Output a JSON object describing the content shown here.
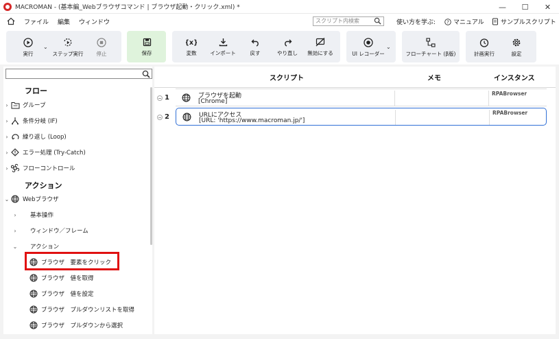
{
  "window": {
    "title": "MACROMAN - (基本編_Webブラウザコマンド | ブラウザ起動・クリック.xml) *",
    "minimize": "—",
    "maximize": "☐",
    "close": "✕"
  },
  "menu": {
    "items": [
      "ファイル",
      "編集",
      "ウィンドウ"
    ],
    "search_placeholder": "スクリプト内検索",
    "learn": "使い方を学ぶ:",
    "manual": "マニュアル",
    "samples": "サンプルスクリプト"
  },
  "toolbar": {
    "run": "実行",
    "step_run": "ステップ実行",
    "stop": "停止",
    "save": "保存",
    "variable": "変数",
    "import": "インポート",
    "undo": "戻す",
    "redo": "やり直し",
    "disable": "無効にする",
    "ui_recorder": "UI レコーダー",
    "flowchart": "フローチャート (β版)",
    "schedule": "計画実行",
    "settings": "設定"
  },
  "tree": {
    "flow_section": "フロー",
    "flow_items": [
      "グループ",
      "条件分岐 (IF)",
      "繰り返し (Loop)",
      "エラー処理 (Try-Catch)",
      "フローコントロール"
    ],
    "action_section": "アクション",
    "web_browser": "Webブラウザ",
    "basic_ops": "基本操作",
    "window_frame": "ウィンドウ／フレーム",
    "actions": "アクション",
    "browser_actions": [
      "ブラウザ　要素をクリック",
      "ブラウザ　値を取得",
      "ブラウザ　値を設定",
      "ブラウザ　プルダウンリストを取得",
      "ブラウザ　プルダウンから選択"
    ]
  },
  "script": {
    "col_script": "スクリプト",
    "col_memo": "メモ",
    "col_instance": "インスタンス",
    "rows": [
      {
        "num": "1",
        "title": "ブラウザを起動",
        "sub": "[Chrome]",
        "instance": "RPABrowser"
      },
      {
        "num": "2",
        "title": "URLにアクセス",
        "sub": "[URL: 'https://www.macroman.jp/']",
        "instance": "RPABrowser"
      }
    ]
  },
  "colors": {
    "accent": "#2f6fd6",
    "highlight": "#e01010",
    "save_bg": "#dff3dc"
  }
}
